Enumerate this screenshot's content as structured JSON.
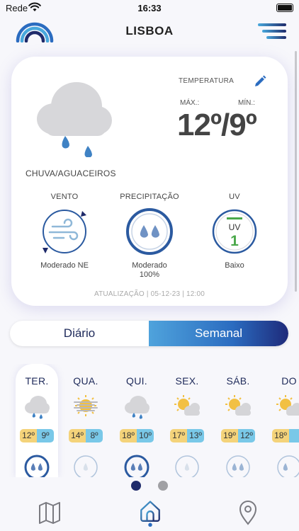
{
  "status_bar": {
    "carrier": "Rede",
    "time": "16:33",
    "wifi_icon": "wifi-icon",
    "battery_icon": "battery-icon"
  },
  "header": {
    "city": "LISBOA",
    "logo_icon": "rainbow-logo-icon",
    "menu_icon": "hamburger-menu-icon"
  },
  "current": {
    "condition": "CHUVA/AGUACEIROS",
    "condition_icon": "rain-cloud-icon",
    "temperature_label": "TEMPERATURA",
    "max_label": "MÁX.:",
    "min_label": "MÍN.:",
    "temperature_value": "12º/9º",
    "max": 12,
    "min": 9,
    "edit_icon": "pencil-icon",
    "wind": {
      "label": "VENTO",
      "value": "Moderado NE",
      "icon": "wind-gauge-icon",
      "direction": "NE"
    },
    "precipitation": {
      "label": "PRECIPITAÇÃO",
      "value_line1": "Moderado",
      "value_line2": "100%",
      "probability": 1.0,
      "icon": "raindrops-gauge-icon"
    },
    "uv": {
      "label": "UV",
      "badge_text": "UV",
      "index": "1",
      "value": "Baixo",
      "icon": "uv-gauge-icon"
    },
    "update": "ATUALIZAÇÃO | 05-12-23 | 12:00"
  },
  "toggle": {
    "daily": "Diário",
    "weekly": "Semanal",
    "selected": "weekly"
  },
  "forecast": [
    {
      "day": "TER.",
      "hi": "12º",
      "lo": "9º",
      "icon": "rain-cloud-icon",
      "selected": true
    },
    {
      "day": "QUA.",
      "hi": "14º",
      "lo": "8º",
      "icon": "sun-fog-icon",
      "selected": false
    },
    {
      "day": "QUI.",
      "hi": "18º",
      "lo": "10º",
      "icon": "rain-cloud-icon",
      "selected": false
    },
    {
      "day": "SEX.",
      "hi": "17º",
      "lo": "13º",
      "icon": "sun-cloud-icon",
      "selected": false
    },
    {
      "day": "SÁB.",
      "hi": "19º",
      "lo": "12º",
      "icon": "sun-cloud-icon",
      "selected": false
    },
    {
      "day": "DO",
      "hi": "18º",
      "lo": "",
      "icon": "sun-cloud-icon",
      "selected": false
    }
  ],
  "pagination": {
    "pages": 2,
    "current": 1
  },
  "tabs": [
    {
      "name": "map",
      "icon": "map-icon"
    },
    {
      "name": "home",
      "icon": "home-icon",
      "active": true
    },
    {
      "name": "location",
      "icon": "location-pin-icon"
    }
  ],
  "colors": {
    "accent_dark": "#1e2a6a",
    "accent_blue": "#2b6cc0",
    "max_temp": "#f4d37a",
    "min_temp": "#79c8e8"
  }
}
